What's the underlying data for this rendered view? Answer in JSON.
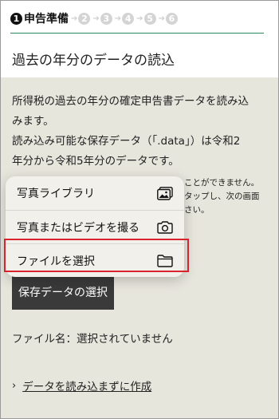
{
  "steps": {
    "current_number": "1",
    "current_label": "申告準備",
    "upcoming": [
      "2",
      "3",
      "4",
      "5",
      "6"
    ]
  },
  "page": {
    "title": "過去の年分のデータの読込"
  },
  "content": {
    "description_lines": [
      "所得税の過去の年分の確定申告書データを読み込",
      "みます。",
      "読み込み可能な保存データ（「.data」）は令和2",
      "年分から令和5年分のデータです。"
    ],
    "note_lines": [
      "ことができません。",
      "タップし、次の画面",
      "さい。"
    ],
    "select_button_label": "保存データの選択",
    "filename_text": "ファイル名：選択されていません",
    "no_data_link_label": "データを読み込まずに作成"
  },
  "popup_menu": {
    "items": [
      {
        "label": "写真ライブラリ",
        "icon": "photo-library-icon"
      },
      {
        "label": "写真またはビデオを撮る",
        "icon": "camera-icon"
      },
      {
        "label": "ファイルを選択",
        "icon": "folder-icon"
      }
    ],
    "highlighted_index": 2,
    "highlight_color": "#d9232e"
  },
  "colors": {
    "accent_line": "#2d8a5f",
    "content_background": "#e7e6dd",
    "button_background": "#3a3a3a"
  }
}
